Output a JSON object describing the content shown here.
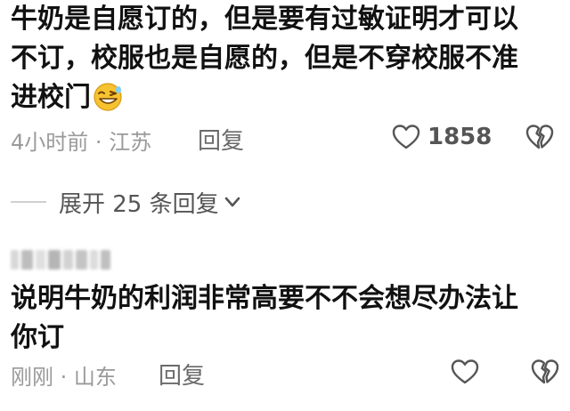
{
  "comments": [
    {
      "text_line1": "牛奶是自愿订的，但是要有过敏证明才可以",
      "text_line2": "不订，校服也是自愿的，但是不穿校服不准",
      "text_line3": "进校门",
      "emoji": "laughing-face",
      "time": "4小时前",
      "separator": "·",
      "location": "江苏",
      "reply_label": "回复",
      "like_count": "1858"
    },
    {
      "username": "",
      "text_line1": "说明牛奶的利润非常高要不不会想尽办法让",
      "text_line2": "你订",
      "time": "刚刚",
      "separator": "·",
      "location": "山东",
      "reply_label": "回复"
    }
  ],
  "expand_replies": {
    "label": "展开 25 条回复"
  },
  "icons": {
    "like": "heart-outline-icon",
    "dislike": "broken-heart-icon",
    "expand": "chevron-down-icon"
  },
  "colors": {
    "text": "#111111",
    "meta": "#9a9a9a",
    "action": "#555555"
  }
}
